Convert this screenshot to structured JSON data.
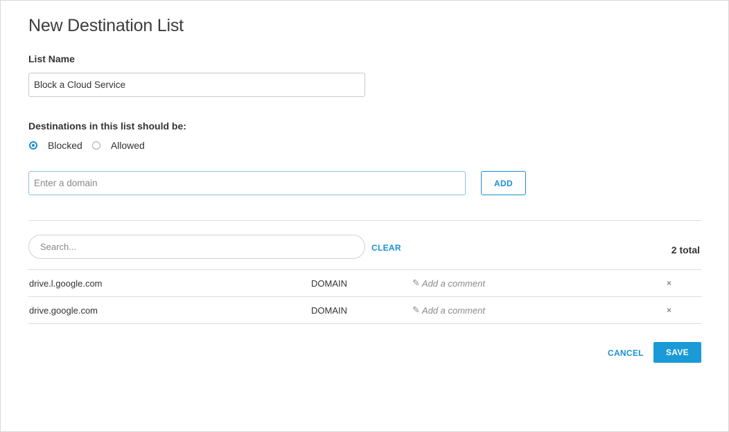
{
  "page": {
    "title": "New Destination List"
  },
  "list_name": {
    "label": "List Name",
    "value": "Block a Cloud Service"
  },
  "destinations": {
    "label": "Destinations in this list should be:",
    "options": [
      {
        "label": "Blocked",
        "selected": true
      },
      {
        "label": "Allowed",
        "selected": false
      }
    ]
  },
  "domain_entry": {
    "placeholder": "Enter a domain",
    "add_label": "ADD"
  },
  "search": {
    "placeholder": "Search...",
    "clear_label": "CLEAR",
    "total": "2 total"
  },
  "rows": [
    {
      "domain": "drive.l.google.com",
      "type": "DOMAIN",
      "comment_placeholder": "Add a comment",
      "remove_icon": "×"
    },
    {
      "domain": "drive.google.com",
      "type": "DOMAIN",
      "comment_placeholder": "Add a comment",
      "remove_icon": "×"
    }
  ],
  "footer": {
    "cancel_label": "CANCEL",
    "save_label": "SAVE"
  },
  "colors": {
    "accent": "#1a8ed1",
    "save_bg": "#1a9ad6"
  }
}
